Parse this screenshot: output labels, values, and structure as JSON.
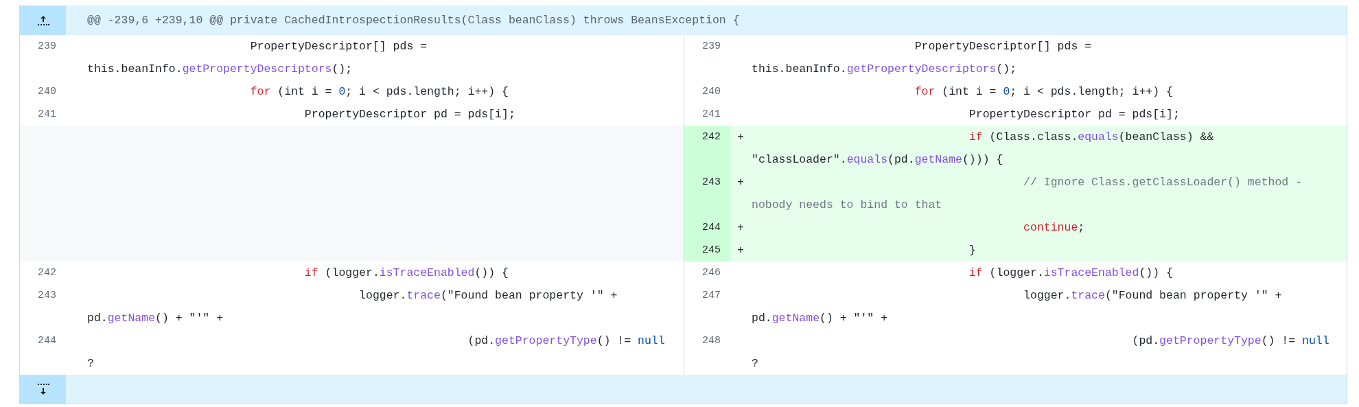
{
  "hunk_header": {
    "text": "@@ -239,6 +239,10 @@ private CachedIntrospectionResults(Class beanClass) throws BeansException {"
  },
  "rows": [
    {
      "left": {
        "kind": "context",
        "number": "239",
        "tokens": [
          {
            "kind": "plain",
            "text": "\t\t\tPropertyDescriptor[] pds = this.beanInfo."
          },
          {
            "kind": "method",
            "text": "getPropertyDescriptors"
          },
          {
            "kind": "plain",
            "text": "();"
          }
        ]
      },
      "right": {
        "kind": "context",
        "number": "239",
        "tokens": [
          {
            "kind": "plain",
            "text": "\t\t\tPropertyDescriptor[] pds = this.beanInfo."
          },
          {
            "kind": "method",
            "text": "getPropertyDescriptors"
          },
          {
            "kind": "plain",
            "text": "();"
          }
        ]
      }
    },
    {
      "left": {
        "kind": "context",
        "number": "240",
        "tokens": [
          {
            "kind": "keyword",
            "text": "\t\t\tfor"
          },
          {
            "kind": "plain",
            "text": " (int i = "
          },
          {
            "kind": "constant",
            "text": "0"
          },
          {
            "kind": "plain",
            "text": "; i < pds.length; i++) {"
          }
        ]
      },
      "right": {
        "kind": "context",
        "number": "240",
        "tokens": [
          {
            "kind": "keyword",
            "text": "\t\t\tfor"
          },
          {
            "kind": "plain",
            "text": " (int i = "
          },
          {
            "kind": "constant",
            "text": "0"
          },
          {
            "kind": "plain",
            "text": "; i < pds.length; i++) {"
          }
        ]
      }
    },
    {
      "left": {
        "kind": "context",
        "number": "241",
        "tokens": [
          {
            "kind": "plain",
            "text": "\t\t\t\tPropertyDescriptor pd = pds[i];"
          }
        ]
      },
      "right": {
        "kind": "context",
        "number": "241",
        "tokens": [
          {
            "kind": "plain",
            "text": "\t\t\t\tPropertyDescriptor pd = pds[i];"
          }
        ]
      }
    },
    {
      "left": {
        "kind": "empty"
      },
      "right": {
        "kind": "added",
        "number": "242",
        "marker": "+",
        "tokens": [
          {
            "kind": "keyword",
            "text": "\t\t\t\tif"
          },
          {
            "kind": "plain",
            "text": " (Class.class."
          },
          {
            "kind": "method",
            "text": "equals"
          },
          {
            "kind": "plain",
            "text": "(beanClass) && \"classLoader\"."
          },
          {
            "kind": "method",
            "text": "equals"
          },
          {
            "kind": "plain",
            "text": "(pd."
          },
          {
            "kind": "method",
            "text": "getName"
          },
          {
            "kind": "plain",
            "text": "())) {"
          }
        ]
      }
    },
    {
      "left": {
        "kind": "empty"
      },
      "right": {
        "kind": "added",
        "number": "243",
        "marker": "+",
        "tokens": [
          {
            "kind": "comment",
            "text": "\t\t\t\t\t// Ignore Class.getClassLoader() method - nobody needs to bind to that"
          }
        ]
      }
    },
    {
      "left": {
        "kind": "empty"
      },
      "right": {
        "kind": "added",
        "number": "244",
        "marker": "+",
        "tokens": [
          {
            "kind": "keyword",
            "text": "\t\t\t\t\tcontinue"
          },
          {
            "kind": "plain",
            "text": ";"
          }
        ]
      }
    },
    {
      "left": {
        "kind": "empty"
      },
      "right": {
        "kind": "added",
        "number": "245",
        "marker": "+",
        "tokens": [
          {
            "kind": "plain",
            "text": "\t\t\t\t}"
          }
        ]
      }
    },
    {
      "left": {
        "kind": "context",
        "number": "242",
        "tokens": [
          {
            "kind": "keyword",
            "text": "\t\t\t\tif"
          },
          {
            "kind": "plain",
            "text": " (logger."
          },
          {
            "kind": "method",
            "text": "isTraceEnabled"
          },
          {
            "kind": "plain",
            "text": "()) {"
          }
        ]
      },
      "right": {
        "kind": "context",
        "number": "246",
        "tokens": [
          {
            "kind": "keyword",
            "text": "\t\t\t\tif"
          },
          {
            "kind": "plain",
            "text": " (logger."
          },
          {
            "kind": "method",
            "text": "isTraceEnabled"
          },
          {
            "kind": "plain",
            "text": "()) {"
          }
        ]
      }
    },
    {
      "left": {
        "kind": "context",
        "number": "243",
        "tokens": [
          {
            "kind": "plain",
            "text": "\t\t\t\t\tlogger."
          },
          {
            "kind": "method",
            "text": "trace"
          },
          {
            "kind": "plain",
            "text": "(\"Found bean property '\" + pd."
          },
          {
            "kind": "method",
            "text": "getName"
          },
          {
            "kind": "plain",
            "text": "() + \"'\" +"
          }
        ]
      },
      "right": {
        "kind": "context",
        "number": "247",
        "tokens": [
          {
            "kind": "plain",
            "text": "\t\t\t\t\tlogger."
          },
          {
            "kind": "method",
            "text": "trace"
          },
          {
            "kind": "plain",
            "text": "(\"Found bean property '\" + pd."
          },
          {
            "kind": "method",
            "text": "getName"
          },
          {
            "kind": "plain",
            "text": "() + \"'\" +"
          }
        ]
      }
    },
    {
      "left": {
        "kind": "context",
        "number": "244",
        "tokens": [
          {
            "kind": "plain",
            "text": "\t\t\t\t\t\t\t(pd."
          },
          {
            "kind": "method",
            "text": "getPropertyType"
          },
          {
            "kind": "plain",
            "text": "() != "
          },
          {
            "kind": "constant",
            "text": "null"
          },
          {
            "kind": "plain",
            "text": " ?"
          }
        ]
      },
      "right": {
        "kind": "context",
        "number": "248",
        "tokens": [
          {
            "kind": "plain",
            "text": "\t\t\t\t\t\t\t(pd."
          },
          {
            "kind": "method",
            "text": "getPropertyType"
          },
          {
            "kind": "plain",
            "text": "() != "
          },
          {
            "kind": "constant",
            "text": "null"
          },
          {
            "kind": "plain",
            "text": " ?"
          }
        ]
      }
    }
  ]
}
